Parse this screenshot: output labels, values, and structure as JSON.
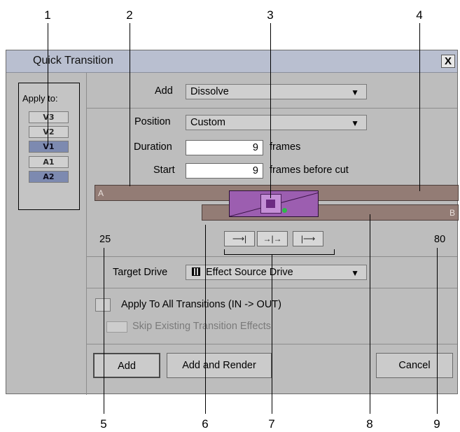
{
  "callouts": [
    "1",
    "2",
    "3",
    "4",
    "5",
    "6",
    "7",
    "8",
    "9"
  ],
  "dialog": {
    "title": "Quick Transition",
    "close": "X"
  },
  "apply_to": {
    "label": "Apply to:",
    "tracks": [
      {
        "label": "V3",
        "selected": false
      },
      {
        "label": "V2",
        "selected": false
      },
      {
        "label": "V1",
        "selected": true
      },
      {
        "label": "A1",
        "selected": false
      },
      {
        "label": "A2",
        "selected": true
      }
    ]
  },
  "add": {
    "label": "Add",
    "value": "Dissolve"
  },
  "position": {
    "label": "Position",
    "value": "Custom"
  },
  "duration": {
    "label": "Duration",
    "value": "9",
    "unit": "frames"
  },
  "start": {
    "label": "Start",
    "value": "9",
    "unit": "frames before cut"
  },
  "timeline": {
    "a_label": "A",
    "b_label": "B",
    "left_value": "25",
    "right_value": "80",
    "align_buttons": [
      "align-end-at-cut",
      "center-on-cut",
      "start-at-cut"
    ]
  },
  "target_drive": {
    "label": "Target Drive",
    "value": "Effect Source Drive",
    "icon": "drive-icon"
  },
  "apply_all": {
    "label": "Apply To All Transitions (IN -> OUT)"
  },
  "skip_existing": {
    "label": "Skip Existing Transition Effects"
  },
  "buttons": {
    "add": "Add",
    "add_render": "Add and Render",
    "cancel": "Cancel"
  },
  "colors": {
    "title_bar": "#b9bfd0",
    "clip_bar": "#937c75",
    "effect": "#9c5eb0",
    "selected_track": "#7d8ab0"
  }
}
